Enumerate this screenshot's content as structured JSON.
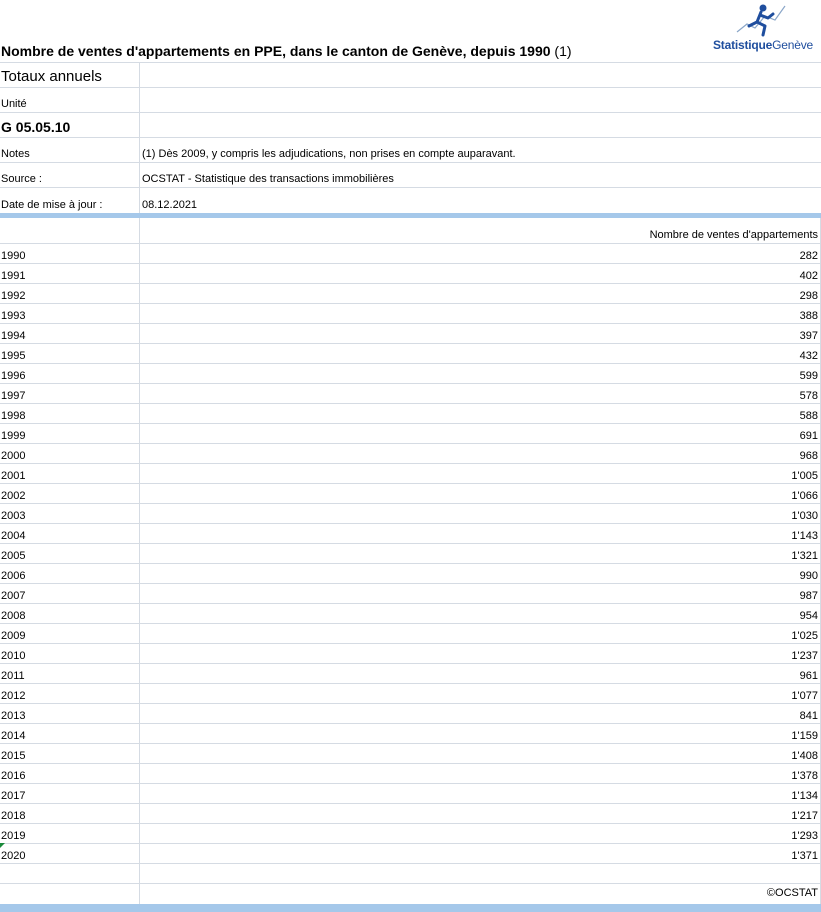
{
  "logo": {
    "bold": "Statistique",
    "light": "Genève"
  },
  "title": {
    "main": "Nombre de ventes d'appartements en PPE, dans le canton de Genève, depuis 1990",
    "note_ref": "(1)"
  },
  "subtitle": "Totaux annuels",
  "meta": {
    "unit_label": "Unité",
    "code": "G 05.05.10",
    "notes_label": "Notes",
    "notes_value": "(1) Dès 2009, y compris les adjudications, non prises en compte auparavant.",
    "source_label": "Source :",
    "source_value": "OCSTAT - Statistique des transactions immobilières",
    "update_label": "Date de mise à jour :",
    "update_value": "08.12.2021"
  },
  "table": {
    "column_header": "Nombre de ventes d'appartements",
    "rows": [
      {
        "year": "1990",
        "value": "282"
      },
      {
        "year": "1991",
        "value": "402"
      },
      {
        "year": "1992",
        "value": "298"
      },
      {
        "year": "1993",
        "value": "388"
      },
      {
        "year": "1994",
        "value": "397"
      },
      {
        "year": "1995",
        "value": "432"
      },
      {
        "year": "1996",
        "value": "599"
      },
      {
        "year": "1997",
        "value": "578"
      },
      {
        "year": "1998",
        "value": "588"
      },
      {
        "year": "1999",
        "value": "691"
      },
      {
        "year": "2000",
        "value": "968"
      },
      {
        "year": "2001",
        "value": "1'005"
      },
      {
        "year": "2002",
        "value": "1'066"
      },
      {
        "year": "2003",
        "value": "1'030"
      },
      {
        "year": "2004",
        "value": "1'143"
      },
      {
        "year": "2005",
        "value": "1'321"
      },
      {
        "year": "2006",
        "value": "990"
      },
      {
        "year": "2007",
        "value": "987"
      },
      {
        "year": "2008",
        "value": "954"
      },
      {
        "year": "2009",
        "value": "1'025"
      },
      {
        "year": "2010",
        "value": "1'237"
      },
      {
        "year": "2011",
        "value": "961"
      },
      {
        "year": "2012",
        "value": "1'077"
      },
      {
        "year": "2013",
        "value": "841"
      },
      {
        "year": "2014",
        "value": "1'159"
      },
      {
        "year": "2015",
        "value": "1'408"
      },
      {
        "year": "2016",
        "value": "1'378"
      },
      {
        "year": "2017",
        "value": "1'134"
      },
      {
        "year": "2018",
        "value": "1'217"
      },
      {
        "year": "2019",
        "value": "1'293"
      },
      {
        "year": "2020",
        "value": "1'371"
      }
    ]
  },
  "footer": {
    "copyright": "©OCSTAT"
  },
  "colors": {
    "band": "#a5c8ea",
    "grid": "#d5dbe3",
    "logo_blue": "#1f4e9e"
  }
}
